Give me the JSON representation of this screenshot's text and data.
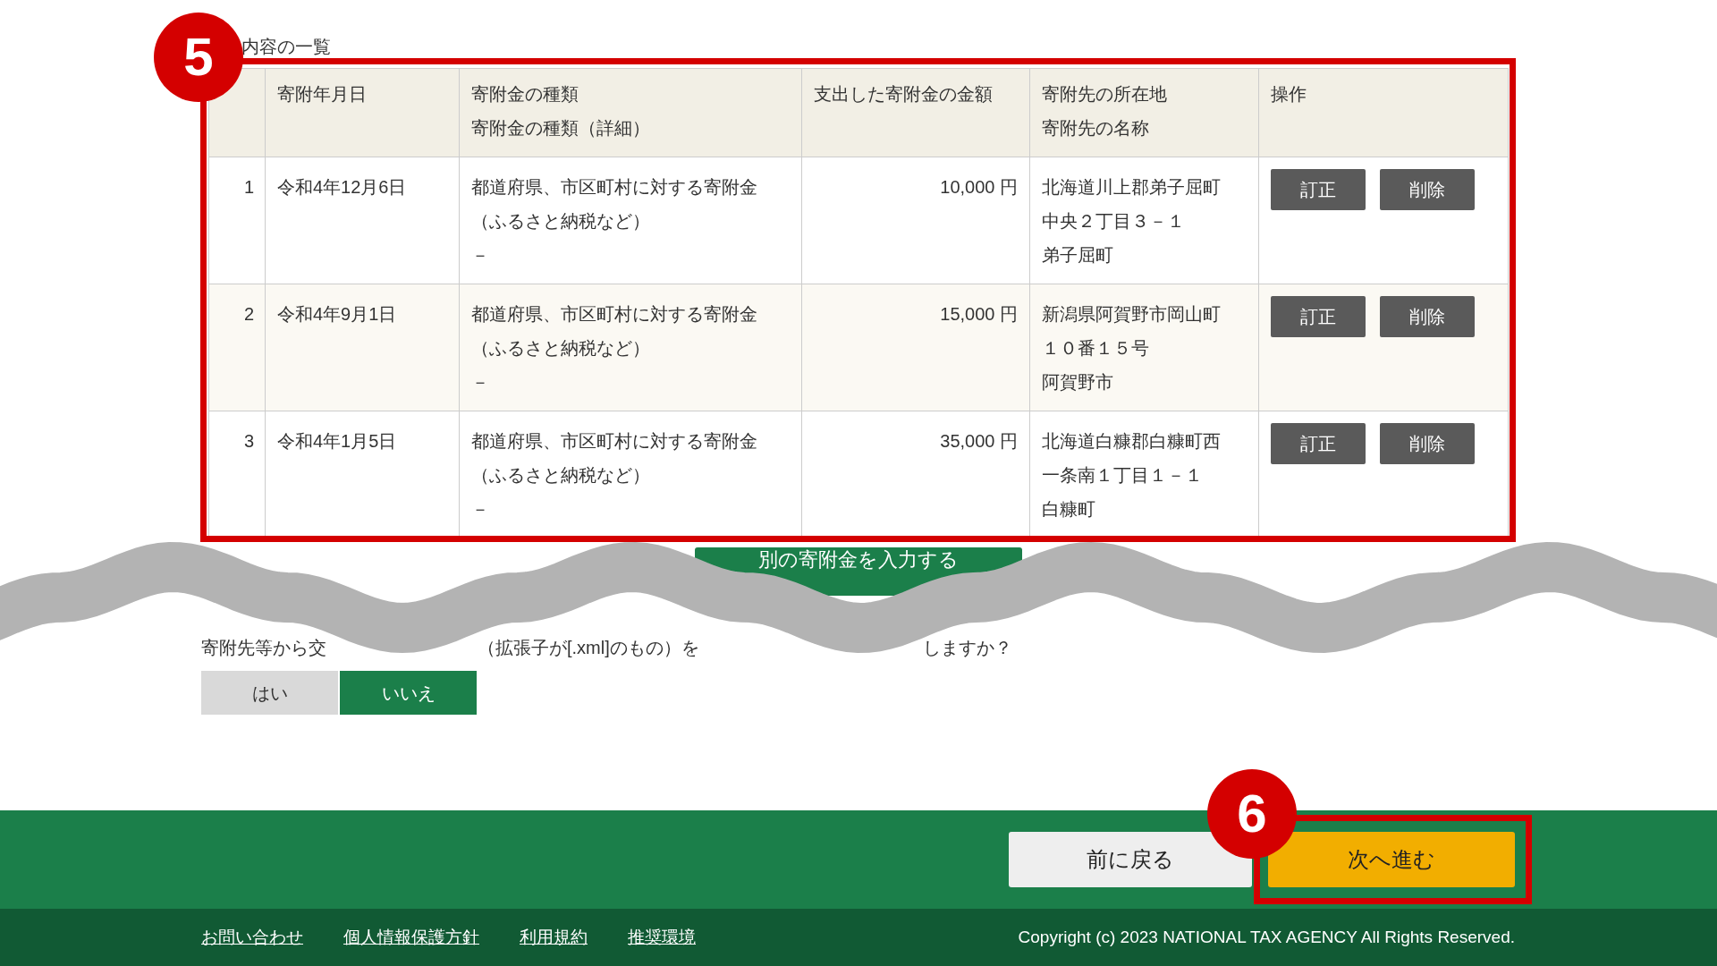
{
  "section_heading": "内容の一覧",
  "table": {
    "columns": [
      [
        "寄附年月日"
      ],
      [
        "寄附金の種類",
        "寄附金の種類（詳細）"
      ],
      [
        "支出した寄附金の金額"
      ],
      [
        "寄附先の所在地",
        "寄附先の名称"
      ],
      [
        "操作"
      ]
    ],
    "rows": [
      {
        "number": "1",
        "date": "令和4年12月6日",
        "type_lines": [
          "都道府県、市区町村に対する寄附金",
          "（ふるさと納税など）",
          "－"
        ],
        "amount": "10,000 円",
        "place_lines": [
          "北海道川上郡弟子屈町",
          "中央２丁目３－１",
          "弟子屈町"
        ],
        "buttons": [
          "訂正",
          "削除"
        ]
      },
      {
        "number": "2",
        "date": "令和4年9月1日",
        "type_lines": [
          "都道府県、市区町村に対する寄附金",
          "（ふるさと納税など）",
          "－"
        ],
        "amount": "15,000 円",
        "place_lines": [
          "新潟県阿賀野市岡山町",
          "１０番１５号",
          "阿賀野市"
        ],
        "buttons": [
          "訂正",
          "削除"
        ]
      },
      {
        "number": "3",
        "date": "令和4年1月5日",
        "type_lines": [
          "都道府県、市区町村に対する寄附金",
          "（ふるさと納税など）",
          "－"
        ],
        "amount": "35,000 円",
        "place_lines": [
          "北海道白糠郡白糠町西",
          "一条南１丁目１－１",
          "白糠町"
        ],
        "buttons": [
          "訂正",
          "削除"
        ]
      }
    ]
  },
  "add_button": "別の寄附金を入力する",
  "question_fragments": [
    "寄附先等から交",
    "（拡張子が[.xml]のもの）を",
    "しますか？"
  ],
  "choices": [
    {
      "label": "はい",
      "selected": false
    },
    {
      "label": "いいえ",
      "selected": true
    }
  ],
  "nav": {
    "back": "前に戻る",
    "next": "次へ進む"
  },
  "footer": {
    "links": [
      "お問い合わせ",
      "個人情報保護方針",
      "利用規約",
      "推奨環境"
    ],
    "copyright": "Copyright (c) 2023 NATIONAL TAX AGENCY All Rights Reserved."
  },
  "annotations": [
    {
      "label": "5"
    },
    {
      "label": "6"
    }
  ]
}
